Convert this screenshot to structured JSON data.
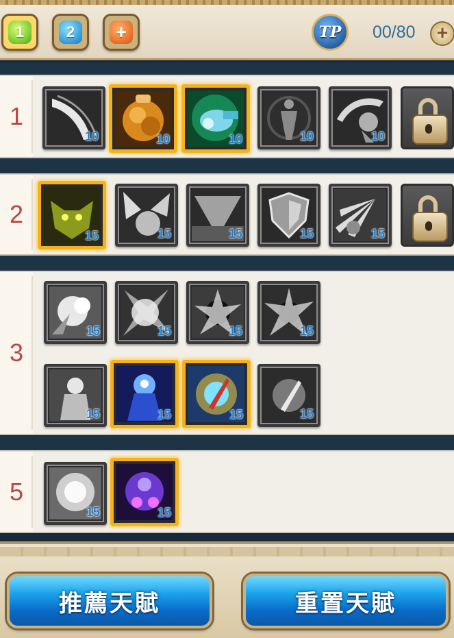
{
  "header": {
    "presets": [
      "1",
      "2",
      "+"
    ],
    "tp_badge": "TP",
    "tp_count": "00/80",
    "tp_add": "+"
  },
  "tiers": [
    {
      "label": "1",
      "skills": [
        {
          "level": "10",
          "selected": false
        },
        {
          "level": "10",
          "selected": true
        },
        {
          "level": "10",
          "selected": true
        },
        {
          "level": "10",
          "selected": false
        },
        {
          "level": "10",
          "selected": false
        },
        {
          "locked": true
        }
      ]
    },
    {
      "label": "2",
      "skills": [
        {
          "level": "15",
          "selected": true
        },
        {
          "level": "15",
          "selected": false
        },
        {
          "level": "15",
          "selected": false
        },
        {
          "level": "15",
          "selected": false
        },
        {
          "level": "15",
          "selected": false
        },
        {
          "locked": true
        }
      ]
    },
    {
      "label": "3",
      "skills": [
        {
          "level": "15",
          "selected": false
        },
        {
          "level": "15",
          "selected": false
        },
        {
          "level": "15",
          "selected": false
        },
        {
          "level": "15",
          "selected": false
        },
        {
          "level": "15",
          "selected": false
        },
        {
          "level": "15",
          "selected": true
        },
        {
          "level": "15",
          "selected": true
        },
        {
          "level": "15",
          "selected": false
        }
      ]
    },
    {
      "label": "5",
      "skills": [
        {
          "level": "15",
          "selected": false
        },
        {
          "level": "15",
          "selected": true
        }
      ]
    }
  ],
  "footer": {
    "recommend_label": "推薦天賦",
    "reset_label": "重置天賦"
  },
  "colors": {
    "selected_border": "#f6b21c",
    "level_text": "#1c7fd4",
    "tier_number": "#b9463f",
    "button_blue": "#1ba3ec"
  }
}
